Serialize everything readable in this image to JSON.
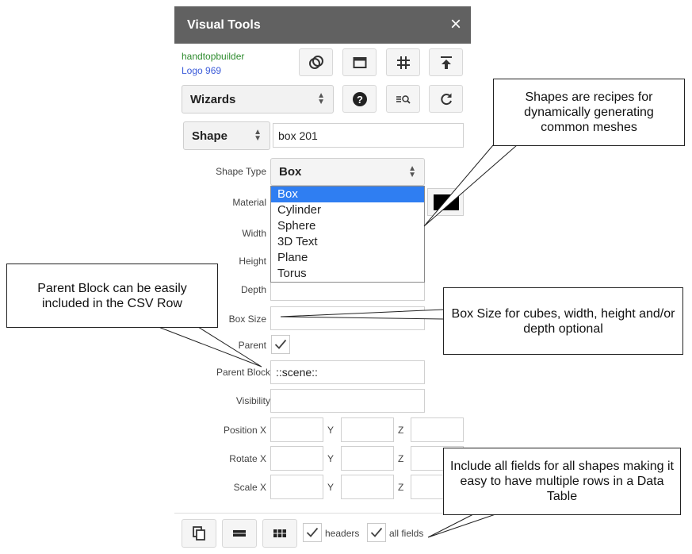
{
  "panel": {
    "title": "Visual Tools",
    "close_icon": "×",
    "user": "handtopbuilder",
    "logo": "Logo 969"
  },
  "toolbar_icons": [
    "rings-icon",
    "window-icon",
    "grid-icon",
    "upload-icon"
  ],
  "wizards": {
    "label": "Wizards"
  },
  "row2_icons": [
    "help-icon",
    "zoom-list-icon",
    "refresh-icon"
  ],
  "entity": {
    "type_label": "Shape",
    "name_value": "box 201"
  },
  "fields": {
    "shape_type_label": "Shape Type",
    "shape_type_value": "Box",
    "material_label": "Material",
    "width_label": "Width",
    "height_label": "Height",
    "depth_label": "Depth",
    "box_size_label": "Box Size",
    "parent_label": "Parent",
    "parent_block_label": "Parent Block",
    "parent_block_value": "::scene::",
    "visibility_label": "Visibility",
    "position_label": "Position X",
    "rotate_label": "Rotate X",
    "scale_label": "Scale X",
    "y_label": "Y",
    "z_label": "Z"
  },
  "shape_options": [
    "Box",
    "Cylinder",
    "Sphere",
    "3D Text",
    "Plane",
    "Torus"
  ],
  "footer": {
    "headers_label": "headers",
    "all_fields_label": "all fields"
  },
  "callouts": {
    "shapes": "Shapes are recipes for dynamically generating common meshes",
    "parent_block": "Parent Block can be easily included in the CSV Row",
    "box_size": "Box Size for cubes, width, height and/or depth optional",
    "all_fields": "Include all fields for all shapes making it easy to have multiple rows in a Data Table"
  },
  "colors": {
    "titlebar": "#616161",
    "user": "#2e8b2e",
    "logo": "#3b5bd9",
    "selected_option": "#2f7ef2",
    "material_swatch": "#000000"
  }
}
